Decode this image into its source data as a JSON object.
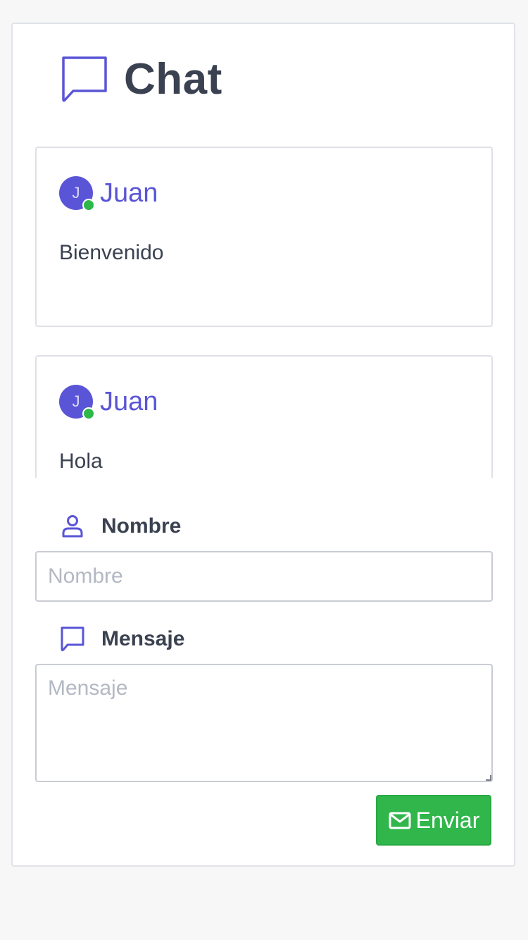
{
  "header": {
    "title": "Chat",
    "icon": "chat-bubble-icon"
  },
  "colors": {
    "accent": "#5a55d6",
    "online": "#2fb84a",
    "send_button": "#30b64b",
    "text": "#3a4150",
    "placeholder": "#b3b8c4"
  },
  "messages": [
    {
      "avatar_initial": "J",
      "author": "Juan",
      "text": "Bienvenido",
      "status": "online"
    },
    {
      "avatar_initial": "J",
      "author": "Juan",
      "text": "Hola",
      "status": "online"
    }
  ],
  "form": {
    "name_label": "Nombre",
    "name_icon": "user-icon",
    "name_placeholder": "Nombre",
    "name_value": "",
    "message_label": "Mensaje",
    "message_icon": "chat-bubble-icon",
    "message_placeholder": "Mensaje",
    "message_value": "",
    "send_label": "Enviar",
    "send_icon": "mail-icon"
  }
}
